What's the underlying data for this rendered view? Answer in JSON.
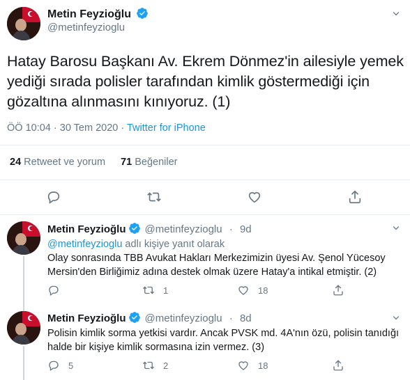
{
  "main_tweet": {
    "author_name": "Metin Feyzioğlu",
    "author_handle": "@metinfeyzioglu",
    "text": "Hatay Barosu Başkanı Av. Ekrem Dönmez'in ailesiyle yemek yediği sırada polisler tarafından kimlik göstermediği için gözaltına alınmasını kınıyoruz. (1)",
    "timestamp": "ÖÖ 10:04 · 30 Tem 2020",
    "separator": " · ",
    "source": "Twitter for iPhone",
    "retweet_count": "24",
    "retweet_label": "Retweet ve yorum",
    "like_count": "71",
    "like_label": "Beğeniler"
  },
  "replies": [
    {
      "author_name": "Metin Feyzioğlu",
      "author_handle": "@metinfeyzioglu",
      "time": "9d",
      "reply_to_handle": "@metinfeyzioglu",
      "reply_to_suffix": " adlı kişiye yanıt olarak",
      "text": "Olay sonrasında TBB Avukat Hakları Merkezimizin üyesi Av. Şenol Yücesoy Mersin'den Birliğimiz adına destek olmak üzere Hatay'a intikal etmiştir. (2)",
      "reply_count": "",
      "retweet_count": "1",
      "like_count": "18"
    },
    {
      "author_name": "Metin Feyzioğlu",
      "author_handle": "@metinfeyzioglu",
      "time": "8d",
      "text": "Polisin kimlik sorma yetkisi vardır. Ancak PVSK md. 4A'nın özü, polisin tanıdığı halde bir kişiye kimlik sormasına izin vermez. (3)",
      "reply_count": "5",
      "retweet_count": "2",
      "like_count": "18"
    }
  ],
  "colors": {
    "accent": "#1da1f2",
    "link": "#1b95e0",
    "muted": "#657786",
    "text": "#14171a",
    "divider": "#e6ecf0"
  },
  "icons": [
    "verified-badge-icon",
    "chevron-down-icon",
    "reply-icon",
    "retweet-icon",
    "like-icon",
    "share-icon"
  ]
}
